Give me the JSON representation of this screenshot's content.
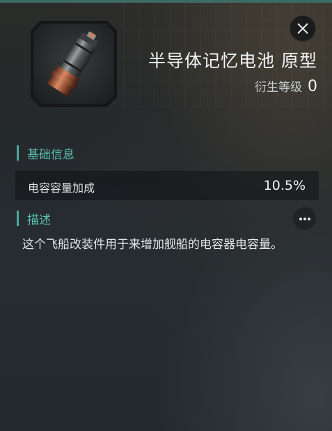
{
  "item": {
    "name": "半导体记忆电池 原型",
    "derive_label": "衍生等级",
    "derive_value": "0",
    "icon": "battery-capacitor-icon"
  },
  "sections": {
    "basic_info": {
      "title": "基础信息",
      "stats": [
        {
          "label": "电容容量加成",
          "value": "10.5%"
        }
      ]
    },
    "description": {
      "title": "描述",
      "text": "这个飞船改装件用于来增加舰船的电容器电容量。"
    }
  },
  "colors": {
    "accent": "#5cbfb1",
    "top_line": "#3e6a66"
  },
  "icons": {
    "close": "close-icon",
    "more": "more-dots-icon"
  }
}
